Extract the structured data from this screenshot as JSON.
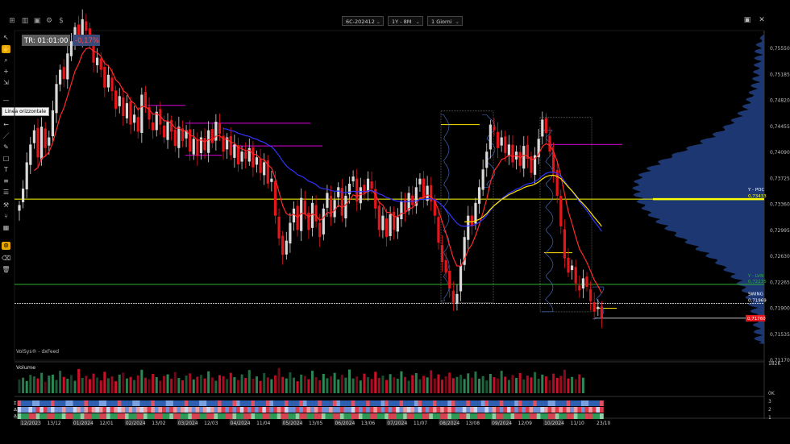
{
  "toolbar": {
    "symbol": "6C-202412",
    "range": "1Y - 8M",
    "interval": "1 Giorni"
  },
  "tools": {
    "tooltip": "Linea orizzontale"
  },
  "overlay": {
    "tr_label": "TR: 01:01:00",
    "change": "-0,17%",
    "source": "VolSys® - dxFeed",
    "volume_title": "Volume",
    "vol_axis_top": "182K",
    "vol_axis_bottom": "0K",
    "ind_axis_top": "3",
    "ind_axis_mid": "2",
    "ind_axis_bottom": "1",
    "rows": [
      "Σ V",
      "Δ V",
      "Δ %"
    ],
    "poc_label": "Y - POC",
    "poc_value": "0,73433",
    "lvn_label": "Y - LVN",
    "lvn_value": "0,72235",
    "swing_label": "SWING",
    "swing_value": "0,71969",
    "last_price": "0,71760"
  },
  "price_axis": [
    "0,75550",
    "0,75185",
    "0,74820",
    "0,74455",
    "0,74090",
    "0,73725",
    "0,73360",
    "0,72995",
    "0,72630",
    "0,72265",
    "0,71900",
    "0,71535",
    "0,71170"
  ],
  "date_axis": [
    {
      "label": "12/2023",
      "boxed": true
    },
    {
      "label": "13/12",
      "boxed": false
    },
    {
      "label": "01/2024",
      "boxed": true
    },
    {
      "label": "12/01",
      "boxed": false
    },
    {
      "label": "02/2024",
      "boxed": true
    },
    {
      "label": "13/02",
      "boxed": false
    },
    {
      "label": "03/2024",
      "boxed": true
    },
    {
      "label": "12/03",
      "boxed": false
    },
    {
      "label": "04/2024",
      "boxed": true
    },
    {
      "label": "11/04",
      "boxed": false
    },
    {
      "label": "05/2024",
      "boxed": true
    },
    {
      "label": "13/05",
      "boxed": false
    },
    {
      "label": "06/2024",
      "boxed": true
    },
    {
      "label": "13/06",
      "boxed": false
    },
    {
      "label": "07/2024",
      "boxed": true
    },
    {
      "label": "11/07",
      "boxed": false
    },
    {
      "label": "08/2024",
      "boxed": true
    },
    {
      "label": "13/08",
      "boxed": false
    },
    {
      "label": "09/2024",
      "boxed": true
    },
    {
      "label": "12/09",
      "boxed": false
    },
    {
      "label": "10/2024",
      "boxed": true
    },
    {
      "label": "11/10",
      "boxed": false
    },
    {
      "label": "23/10",
      "boxed": false
    }
  ],
  "colors": {
    "up": "#d9d9d9",
    "down": "#e5161b",
    "ema_fast": "#ff2a2a",
    "ema_slow": "#3333ff",
    "vwap": "#ffe600",
    "poc_line": "#ffff00",
    "lvn_line": "#2fb52f",
    "profile": "#1e3a78",
    "purple": "#b000b0",
    "vol_up": "#2e8b57",
    "vol_down": "#d0102a"
  },
  "chart_data": {
    "type": "candlestick",
    "closes": [
      0.7335,
      0.7358,
      0.7395,
      0.742,
      0.744,
      0.7402,
      0.7445,
      0.7415,
      0.743,
      0.7468,
      0.7505,
      0.7525,
      0.7512,
      0.7548,
      0.7565,
      0.7585,
      0.757,
      0.7596,
      0.758,
      0.756,
      0.7535,
      0.7542,
      0.7525,
      0.75,
      0.7518,
      0.7495,
      0.747,
      0.7488,
      0.746,
      0.7478,
      0.7448,
      0.7462,
      0.7438,
      0.749,
      0.7472,
      0.7455,
      0.744,
      0.7466,
      0.7448,
      0.743,
      0.7452,
      0.7438,
      0.7418,
      0.7445,
      0.7425,
      0.744,
      0.741,
      0.7428,
      0.7404,
      0.743,
      0.7412,
      0.744,
      0.7422,
      0.7452,
      0.7435,
      0.741,
      0.743,
      0.7405,
      0.742,
      0.7392,
      0.741,
      0.74,
      0.7415,
      0.7388,
      0.7402,
      0.738,
      0.7395,
      0.7365,
      0.7372,
      0.732,
      0.7288,
      0.7265,
      0.7285,
      0.731,
      0.733,
      0.73,
      0.7345,
      0.7322,
      0.73,
      0.7338,
      0.7312,
      0.729,
      0.733,
      0.7352,
      0.7318,
      0.7342,
      0.736,
      0.732,
      0.7348,
      0.7365,
      0.7375,
      0.734,
      0.736,
      0.7352,
      0.7372,
      0.7358,
      0.733,
      0.73,
      0.732,
      0.729,
      0.7322,
      0.73,
      0.7318,
      0.734,
      0.7325,
      0.7352,
      0.7335,
      0.736,
      0.7372,
      0.7345,
      0.7362,
      0.734,
      0.732,
      0.7282,
      0.7255,
      0.724,
      0.7218,
      0.7198,
      0.721,
      0.725,
      0.729,
      0.732,
      0.7305,
      0.7338,
      0.736,
      0.7385,
      0.741,
      0.7448,
      0.744,
      0.7415,
      0.743,
      0.7408,
      0.742,
      0.7395,
      0.741,
      0.739,
      0.7418,
      0.74,
      0.738,
      0.7405,
      0.7428,
      0.7455,
      0.7436,
      0.741,
      0.738,
      0.7348,
      0.7305,
      0.726,
      0.724,
      0.725,
      0.7225,
      0.7215,
      0.7232,
      0.722,
      0.72,
      0.7185,
      0.7192,
      0.7176
    ],
    "y_range": [
      0.7117,
      0.758
    ],
    "poc": 0.73433,
    "lvn": 0.72235,
    "swing": 0.71969,
    "last": 0.7176,
    "volumes": [
      54,
      61,
      48,
      72,
      66,
      58,
      80,
      45,
      69,
      73,
      52,
      88,
      64,
      57,
      71,
      49,
      95,
      60,
      68,
      55,
      77,
      62,
      50,
      84,
      59,
      66,
      47,
      73,
      81,
      58,
      64,
      52,
      70,
      92,
      61,
      55,
      76,
      63,
      49,
      68,
      74,
      57,
      83,
      60,
      51,
      69,
      78,
      54,
      65,
      72,
      58,
      86,
      62,
      49,
      71,
      67,
      56,
      80,
      63,
      52,
      74,
      60,
      91,
      57,
      66,
      48,
      79,
      62,
      55,
      70,
      99,
      64,
      58,
      82,
      61,
      47,
      73,
      68,
      55,
      88,
      63,
      51,
      76,
      59,
      67,
      80,
      54,
      72,
      61,
      93,
      58,
      66,
      50,
      77,
      63,
      56,
      84,
      60,
      69,
      52,
      75,
      62,
      57,
      86,
      64,
      49,
      71,
      79,
      55,
      68,
      62,
      90,
      58,
      74,
      53,
      66,
      81,
      59,
      64,
      72,
      56,
      78,
      61,
      85,
      57,
      67,
      50,
      76,
      63,
      58,
      88,
      65,
      52,
      71,
      60,
      79,
      54,
      69,
      62,
      83,
      57,
      73,
      66,
      51,
      77,
      60,
      68,
      92,
      58,
      64,
      55,
      74,
      61
    ],
    "vol_max": 182
  }
}
